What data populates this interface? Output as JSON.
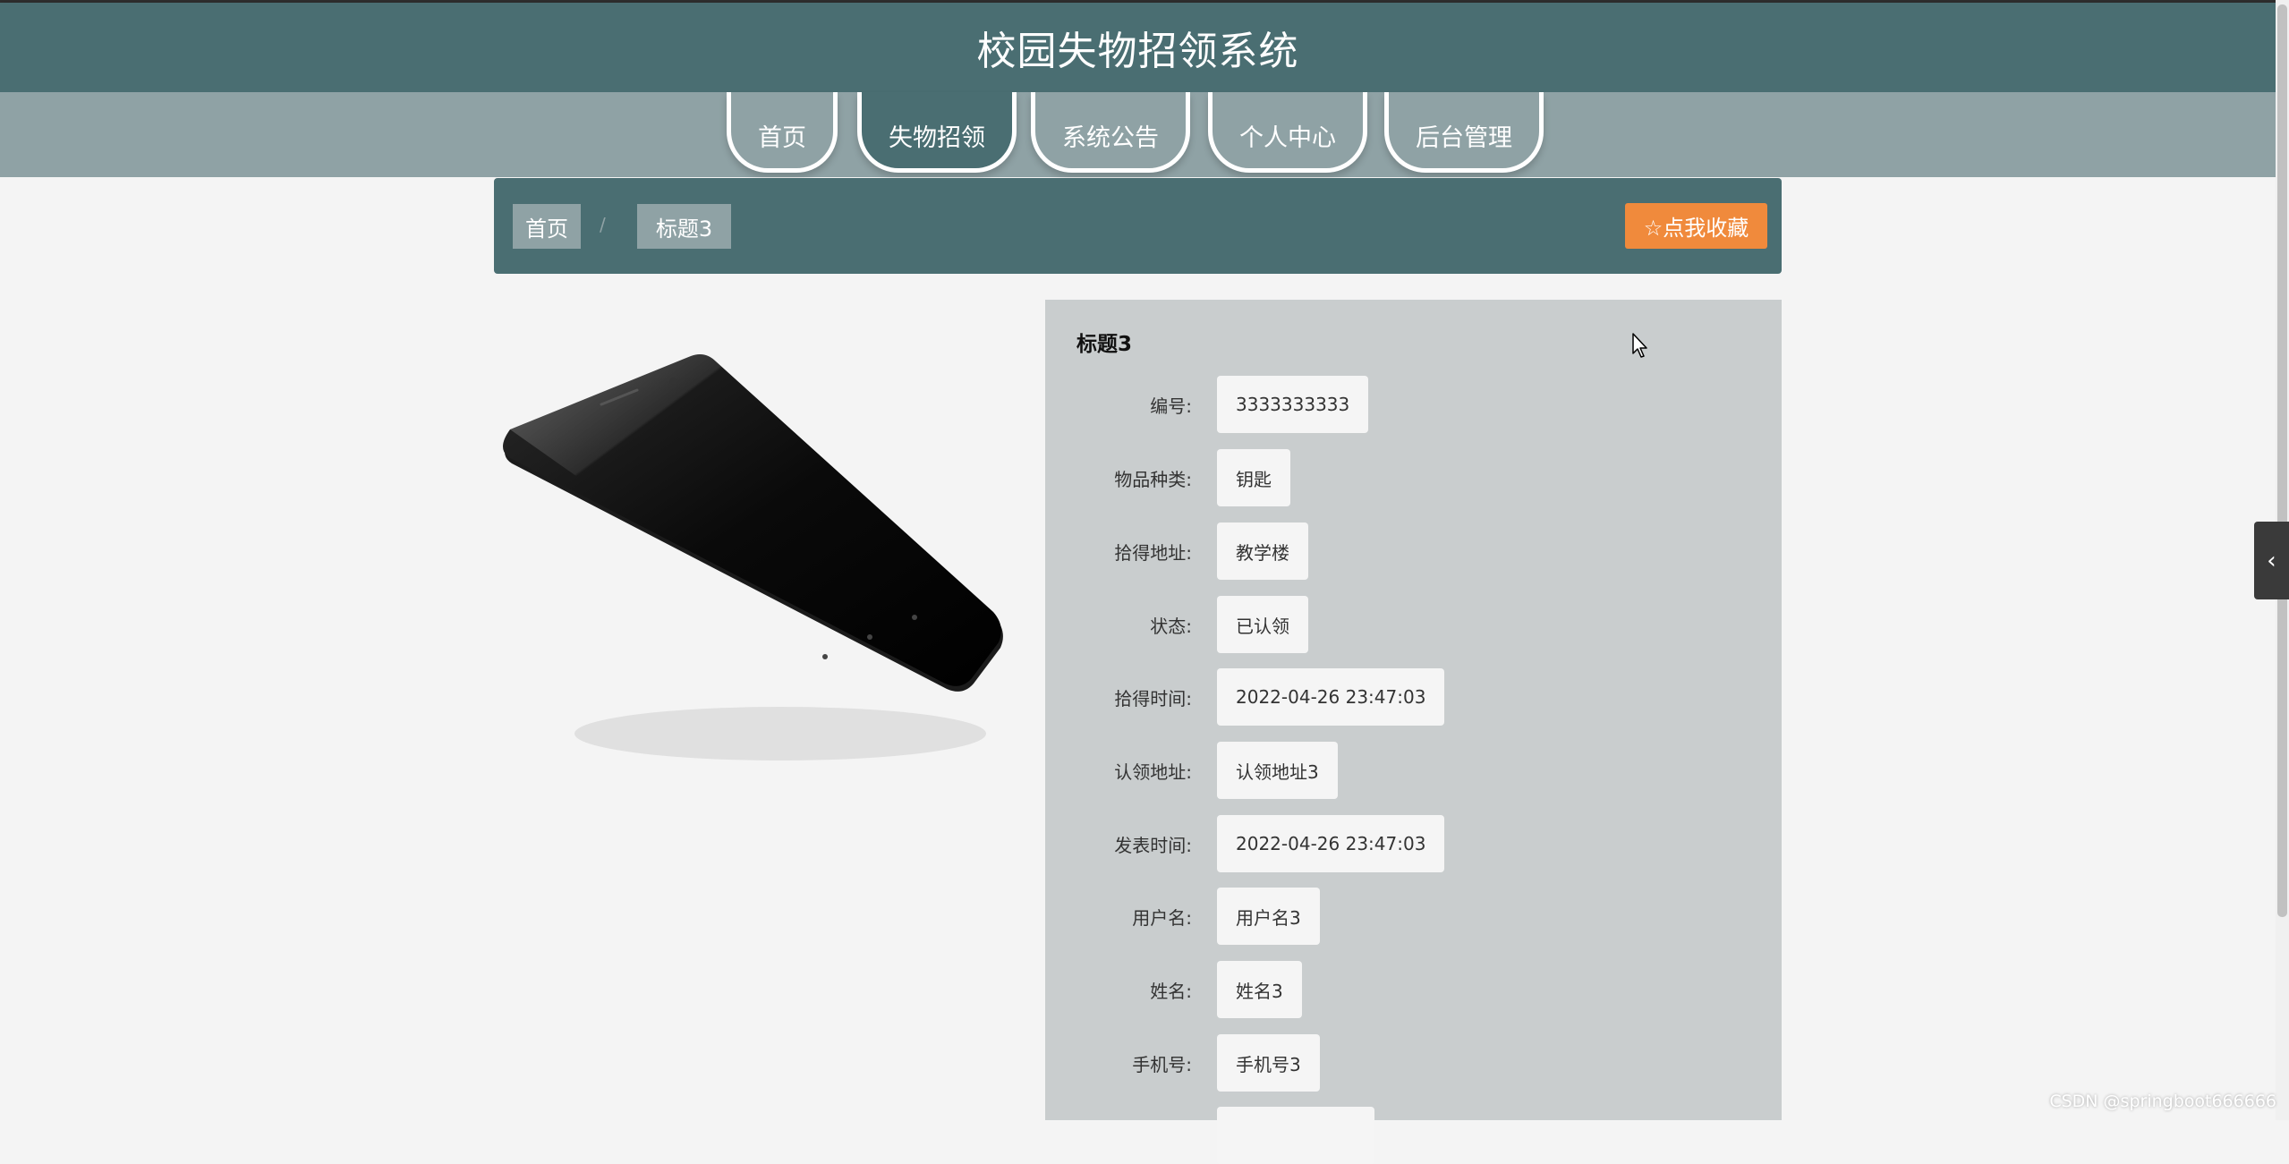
{
  "header": {
    "title": "校园失物招领系统"
  },
  "nav": {
    "items": [
      {
        "label": "首页"
      },
      {
        "label": "失物招领"
      },
      {
        "label": "系统公告"
      },
      {
        "label": "个人中心"
      },
      {
        "label": "后台管理"
      }
    ]
  },
  "breadcrumb": {
    "home": "首页",
    "separator": "/",
    "current": "标题3"
  },
  "favorite": {
    "icon": "star-outline-icon",
    "label": "☆点我收藏"
  },
  "detail": {
    "title": "标题3",
    "fields": [
      {
        "label": "编号:",
        "value": "3333333333"
      },
      {
        "label": "物品种类:",
        "value": "钥匙"
      },
      {
        "label": "拾得地址:",
        "value": "教学楼"
      },
      {
        "label": "状态:",
        "value": "已认领"
      },
      {
        "label": "拾得时间:",
        "value": "2022-04-26 23:47:03"
      },
      {
        "label": "认领地址:",
        "value": "认领地址3"
      },
      {
        "label": "发表时间:",
        "value": "2022-04-26 23:47:03"
      },
      {
        "label": "用户名:",
        "value": "用户名3"
      },
      {
        "label": "姓名:",
        "value": "姓名3"
      },
      {
        "label": "手机号:",
        "value": "手机号3"
      }
    ]
  },
  "side_toggle": {
    "label": "‹",
    "icon": "chevron-left-icon"
  },
  "watermark": "CSDN @springboot666666",
  "colors": {
    "primary": "#4a6e72",
    "secondary": "#8fa2a5",
    "accent": "#f08a3c",
    "panel": "#c9cdce"
  }
}
